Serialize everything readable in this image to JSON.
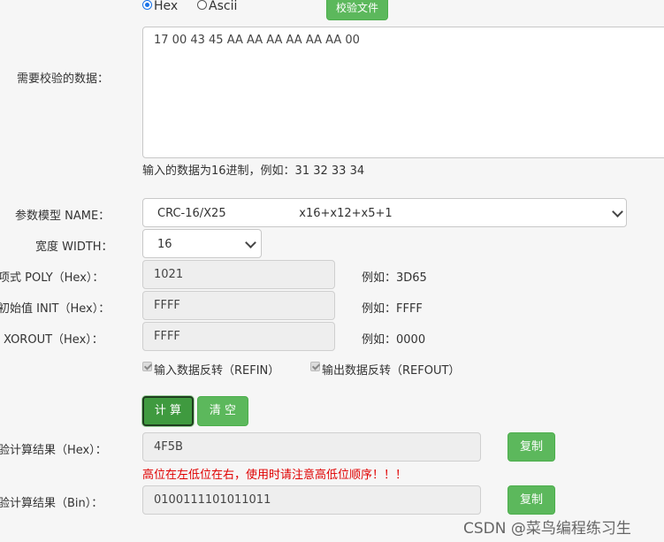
{
  "format": {
    "hex_label": "Hex",
    "ascii_label": "Ascii",
    "selected": "Hex",
    "verify_file_button": "校验文件"
  },
  "data_input": {
    "label": "需要校验的数据：",
    "value": "17 00 43 45 AA AA AA AA AA AA 00",
    "hint": "输入的数据为16进制，例如：31 32 33 34"
  },
  "model": {
    "label": "参数模型 NAME：",
    "selected": "CRC-16/X25                    x16+x12+x5+1"
  },
  "width": {
    "label": "宽度 WIDTH：",
    "selected": "16"
  },
  "poly": {
    "label": "项式 POLY（Hex）：",
    "value": "1021",
    "example": "例如：3D65"
  },
  "init": {
    "label": "初始值 INIT（Hex）：",
    "value": "FFFF",
    "example": "例如：FFFF"
  },
  "xorout": {
    "label": "XOROUT（Hex）：",
    "value": "FFFF",
    "example": "例如：0000"
  },
  "options": {
    "refin_label": "输入数据反转（REFIN）",
    "refout_label": "输出数据反转（REFOUT）",
    "refin_checked": true,
    "refout_checked": true
  },
  "actions": {
    "calc_button": "计 算",
    "clear_button": "清 空"
  },
  "result_hex": {
    "label": "验计算结果（Hex）：",
    "value": "4F5B",
    "copy_button": "复制",
    "warning": "高位在左低位在右，使用时请注意高低位顺序！！！"
  },
  "result_bin": {
    "label": "验计算结果（Bin）：",
    "value": "0100111101011011",
    "copy_button": "复制"
  },
  "watermark": "CSDN @菜鸟编程练习生",
  "colors": {
    "accent_green": "#5cb85c",
    "warning_red": "#e00000",
    "radio_blue": "#1a73e8"
  }
}
